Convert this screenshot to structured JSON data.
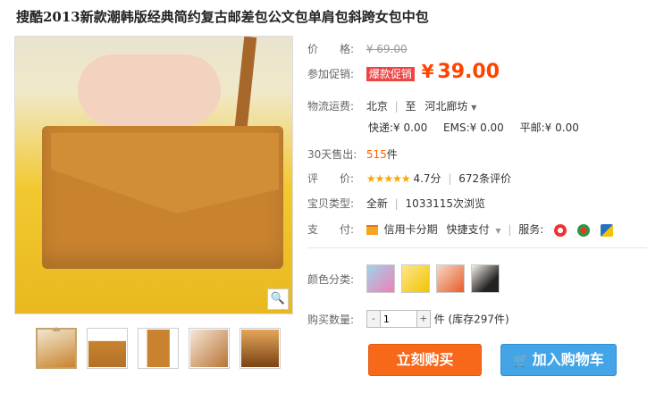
{
  "title": "搜酷2013新款潮韩版经典简约复古邮差包公文包单肩包斜跨女包中包",
  "image": {
    "zoom_icon": "magnifier-icon"
  },
  "price": {
    "label": "价　　格:",
    "original": "¥ 69.00"
  },
  "promo": {
    "label": "参加促销:",
    "tag": "爆款促销",
    "yen": "¥",
    "price": "39.00"
  },
  "shipping": {
    "label": "物流运费:",
    "from": "北京",
    "to_word": "至",
    "to": "河北廊坊",
    "express": "快递:¥ 0.00",
    "ems": "EMS:¥ 0.00",
    "post": "平邮:¥ 0.00"
  },
  "sales": {
    "label": "30天售出:",
    "count": "515",
    "unit": "件"
  },
  "rating": {
    "label": "评　　价:",
    "stars": "★★★★★",
    "score": "4.7分",
    "reviews": "672条评价"
  },
  "type": {
    "label": "宝贝类型:",
    "condition": "全新",
    "views": "1033115次浏览"
  },
  "payment": {
    "label": "支　　付:",
    "credit": "信用卡分期",
    "quick": "快捷支付",
    "service_label": "服务:"
  },
  "color": {
    "label": "颜色分类:"
  },
  "quantity": {
    "label": "购买数量:",
    "minus": "-",
    "value": "1",
    "plus": "+",
    "stock": "件 (库存297件)"
  },
  "buttons": {
    "buy": "立刻购买",
    "cart": "加入购物车"
  }
}
